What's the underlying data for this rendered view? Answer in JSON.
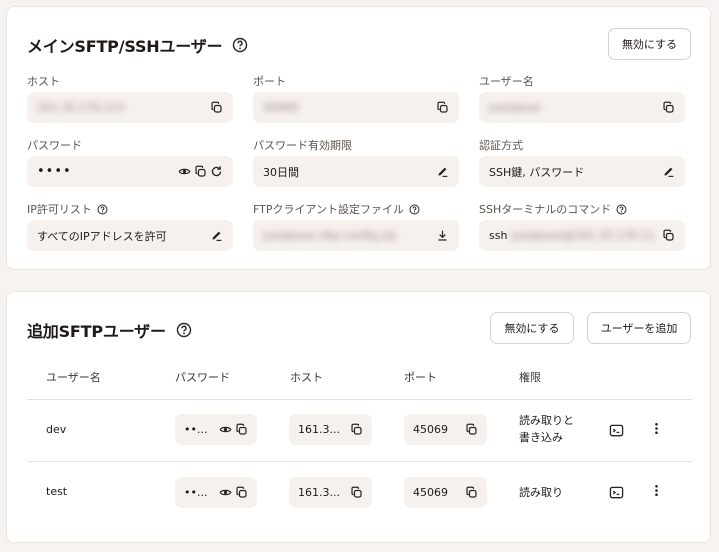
{
  "main_user": {
    "title": "メインSFTP/SSHユーザー",
    "disable_label": "無効にする",
    "host": {
      "label": "ホスト",
      "value": "161.35.176.113"
    },
    "port": {
      "label": "ポート",
      "value": "45069"
    },
    "username": {
      "label": "ユーザー名",
      "value": "justabout"
    },
    "password": {
      "label": "パスワード",
      "value": "••••"
    },
    "password_expiry": {
      "label": "パスワード有効期限",
      "value": "30日間"
    },
    "auth_method": {
      "label": "認証方式",
      "value": "SSH鍵, パスワード"
    },
    "ip_allowlist": {
      "label": "IP許可リスト",
      "value": "すべてのIPアドレスを許可"
    },
    "ftp_config": {
      "label": "FTPクライアント設定ファイル",
      "value": "justabout-sftp-config.zip"
    },
    "ssh_command": {
      "label": "SSHターミナルのコマンド",
      "prefix": "ssh",
      "value": "justabout@161.35.176.11"
    }
  },
  "additional_users": {
    "title": "追加SFTPユーザー",
    "disable_label": "無効にする",
    "add_label": "ユーザーを追加",
    "columns": [
      "ユーザー名",
      "パスワード",
      "ホスト",
      "ポート",
      "権限"
    ],
    "rows": [
      {
        "username": "dev",
        "password": "••...",
        "host": "161.3...",
        "port": "45069",
        "permission_line1": "読み取りと",
        "permission_line2": "書き込み"
      },
      {
        "username": "test",
        "password": "••...",
        "host": "161.3...",
        "port": "45069",
        "permission_line1": "読み取り",
        "permission_line2": ""
      }
    ]
  },
  "icons": {
    "help": "question-circle-icon",
    "copy": "copy-icon",
    "eye": "eye-icon",
    "refresh": "refresh-icon",
    "edit": "pencil-icon",
    "download": "download-icon",
    "terminal": "terminal-icon",
    "more": "more-vertical-icon"
  }
}
